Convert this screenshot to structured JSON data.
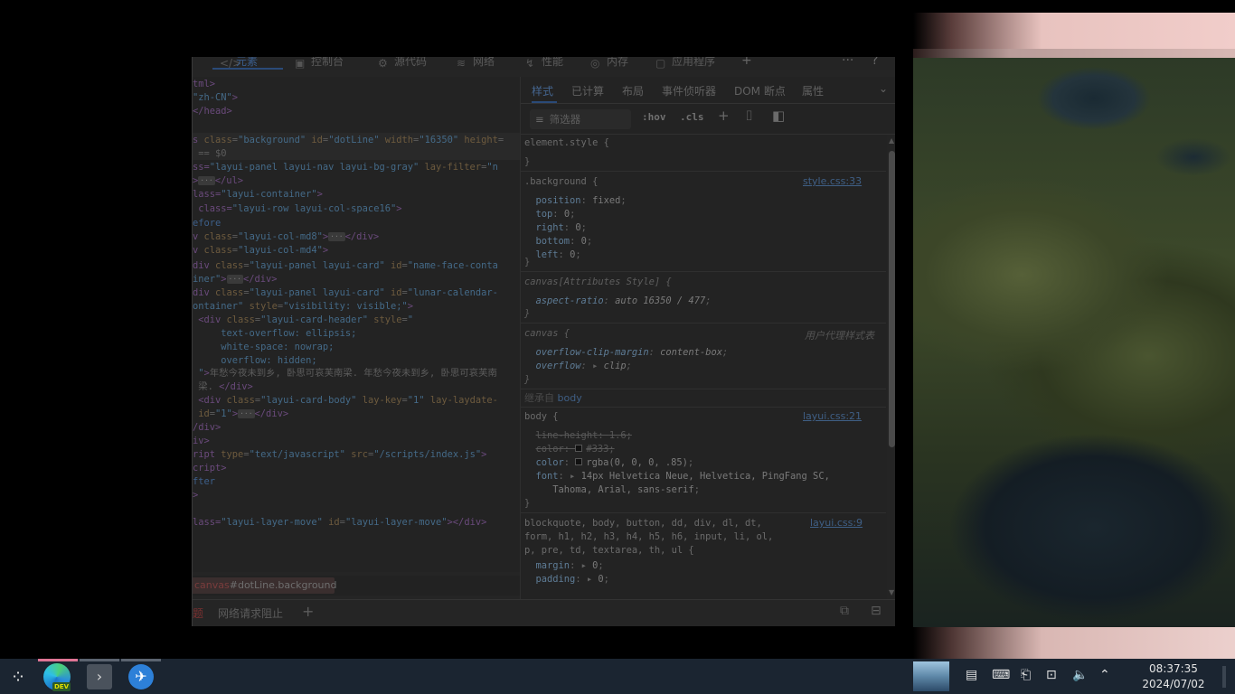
{
  "devtools": {
    "tabs": [
      {
        "label": "元素",
        "icon": "</>"
      },
      {
        "label": "控制台",
        "icon": "▣"
      },
      {
        "label": "源代码",
        "icon": "⚙"
      },
      {
        "label": "网络",
        "icon": "≋"
      },
      {
        "label": "性能",
        "icon": "↯"
      },
      {
        "label": "内存",
        "icon": "◎"
      },
      {
        "label": "应用程序",
        "icon": "▢"
      }
    ],
    "add_tab": "+",
    "more": "···",
    "help": "?",
    "elements_lines": [
      {
        "parts": [
          [
            "tg",
            "tml>"
          ]
        ]
      },
      {
        "parts": [
          [
            "av",
            "\"zh-CN\""
          ],
          [
            "tg",
            ">"
          ]
        ]
      },
      {
        "parts": [
          [
            "tg",
            "</head>"
          ]
        ]
      },
      {
        "parts": []
      },
      {
        "parts": [
          [
            "tg",
            "s "
          ],
          [
            "an",
            "class"
          ],
          [
            "tx",
            "="
          ],
          [
            "av",
            "\"background\""
          ],
          [
            "tx",
            " "
          ],
          [
            "an",
            "id"
          ],
          [
            "tx",
            "="
          ],
          [
            "av",
            "\"dotLine\""
          ],
          [
            "tx",
            " "
          ],
          [
            "an",
            "width"
          ],
          [
            "tx",
            "="
          ],
          [
            "av",
            "\"16350\""
          ],
          [
            "tx",
            " "
          ],
          [
            "an",
            "height"
          ],
          [
            "tx",
            "="
          ]
        ]
      },
      {
        "parts": [
          [
            "tx",
            " == $0"
          ]
        ]
      },
      {
        "parts": [
          [
            "tg",
            "ss="
          ],
          [
            "av",
            "\"layui-panel layui-nav layui-bg-gray\""
          ],
          [
            "tx",
            " "
          ],
          [
            "an",
            "lay-filter"
          ],
          [
            "tx",
            "="
          ],
          [
            "av",
            "\"n"
          ]
        ]
      },
      {
        "parts": [
          [
            "tg",
            ">"
          ],
          [
            "ell",
            "···"
          ],
          [
            "tg",
            "</ul>"
          ]
        ]
      },
      {
        "parts": [
          [
            "tg",
            "lass="
          ],
          [
            "av",
            "\"layui-container\""
          ],
          [
            "tg",
            ">"
          ]
        ]
      },
      {
        "parts": [
          [
            "tg",
            " class="
          ],
          [
            "av",
            "\"layui-row layui-col-space16\""
          ],
          [
            "tg",
            ">"
          ]
        ]
      },
      {
        "parts": [
          [
            "pseudo",
            "efore"
          ]
        ]
      },
      {
        "parts": [
          [
            "tg",
            "v "
          ],
          [
            "an",
            "class"
          ],
          [
            "tx",
            "="
          ],
          [
            "av",
            "\"layui-col-md8\""
          ],
          [
            "tg",
            ">"
          ],
          [
            "ell",
            "···"
          ],
          [
            "tg",
            "</div>"
          ]
        ]
      },
      {
        "parts": [
          [
            "tg",
            "v "
          ],
          [
            "an",
            "class"
          ],
          [
            "tx",
            "="
          ],
          [
            "av",
            "\"layui-col-md4\""
          ],
          [
            "tg",
            ">"
          ]
        ]
      },
      {
        "parts": [
          [
            "tg",
            "div "
          ],
          [
            "an",
            "class"
          ],
          [
            "tx",
            "="
          ],
          [
            "av",
            "\"layui-panel layui-card\""
          ],
          [
            "tx",
            " "
          ],
          [
            "an",
            "id"
          ],
          [
            "tx",
            "="
          ],
          [
            "av",
            "\"name-face-conta"
          ]
        ]
      },
      {
        "parts": [
          [
            "av",
            "iner\""
          ],
          [
            "tg",
            ">"
          ],
          [
            "ell",
            "···"
          ],
          [
            "tg",
            "</div>"
          ]
        ]
      },
      {
        "parts": [
          [
            "tg",
            "div "
          ],
          [
            "an",
            "class"
          ],
          [
            "tx",
            "="
          ],
          [
            "av",
            "\"layui-panel layui-card\""
          ],
          [
            "tx",
            " "
          ],
          [
            "an",
            "id"
          ],
          [
            "tx",
            "="
          ],
          [
            "av",
            "\"lunar-calendar-"
          ]
        ]
      },
      {
        "parts": [
          [
            "av",
            "ontainer\""
          ],
          [
            "tx",
            " "
          ],
          [
            "an",
            "style"
          ],
          [
            "tx",
            "="
          ],
          [
            "av",
            "\"visibility: visible;\""
          ],
          [
            "tg",
            ">"
          ]
        ]
      },
      {
        "parts": [
          [
            "tg",
            " <div "
          ],
          [
            "an",
            "class"
          ],
          [
            "tx",
            "="
          ],
          [
            "av",
            "\"layui-card-header\""
          ],
          [
            "tx",
            " "
          ],
          [
            "an",
            "style"
          ],
          [
            "tx",
            "="
          ],
          [
            "av",
            "\""
          ]
        ]
      },
      {
        "parts": [
          [
            "av",
            "     text-overflow: ellipsis;"
          ]
        ]
      },
      {
        "parts": [
          [
            "av",
            "     white-space: nowrap;"
          ]
        ]
      },
      {
        "parts": [
          [
            "av",
            "     overflow: hidden;"
          ]
        ]
      },
      {
        "parts": [
          [
            "av",
            " \""
          ],
          [
            "tg",
            ">"
          ],
          [
            "tx",
            "年愁今夜未到乡, 卧思可哀芙南梁. 年愁今夜未到乡, 卧思可哀芙南"
          ]
        ]
      },
      {
        "parts": [
          [
            "tx",
            " 梁. "
          ],
          [
            "tg",
            "</div>"
          ]
        ]
      },
      {
        "parts": [
          [
            "tg",
            " <div "
          ],
          [
            "an",
            "class"
          ],
          [
            "tx",
            "="
          ],
          [
            "av",
            "\"layui-card-body\""
          ],
          [
            "tx",
            " "
          ],
          [
            "an",
            "lay-key"
          ],
          [
            "tx",
            "="
          ],
          [
            "av",
            "\"1\""
          ],
          [
            "tx",
            " "
          ],
          [
            "an",
            "lay-laydate-"
          ]
        ]
      },
      {
        "parts": [
          [
            "an",
            " id"
          ],
          [
            "tx",
            "="
          ],
          [
            "av",
            "\"1\""
          ],
          [
            "tg",
            ">"
          ],
          [
            "ell",
            "···"
          ],
          [
            "tg",
            "</div>"
          ]
        ]
      },
      {
        "parts": [
          [
            "tg",
            "/div>"
          ]
        ]
      },
      {
        "parts": [
          [
            "tg",
            "iv>"
          ]
        ]
      },
      {
        "parts": [
          [
            "tg",
            "ript "
          ],
          [
            "an",
            "type"
          ],
          [
            "tx",
            "="
          ],
          [
            "av",
            "\"text/javascript\""
          ],
          [
            "tx",
            " "
          ],
          [
            "an",
            "src"
          ],
          [
            "tx",
            "="
          ],
          [
            "av",
            "\"/scripts/index.js\""
          ],
          [
            "tg",
            ">"
          ]
        ]
      },
      {
        "parts": [
          [
            "tg",
            "cript>"
          ]
        ]
      },
      {
        "parts": [
          [
            "pseudo",
            "fter"
          ]
        ]
      },
      {
        "parts": [
          [
            "tg",
            ">"
          ]
        ]
      },
      {
        "parts": []
      },
      {
        "parts": [
          [
            "tg",
            "lass="
          ],
          [
            "av",
            "\"layui-layer-move\""
          ],
          [
            "tx",
            " "
          ],
          [
            "an",
            "id"
          ],
          [
            "tx",
            "="
          ],
          [
            "av",
            "\"layui-layer-move\""
          ],
          [
            "tg",
            "></div>"
          ]
        ]
      }
    ],
    "breadcrumb": {
      "tag": "canvas",
      "rest": "#dotLine.background"
    },
    "bottom": {
      "left_label": "题",
      "drawer_tab": "网络请求阻止",
      "add": "+"
    },
    "styles_tabs": [
      "样式",
      "已计算",
      "布局",
      "事件侦听器",
      "DOM 断点",
      "属性"
    ],
    "filter": {
      "placeholder": "筛选器",
      "hov": ":hov",
      "cls": ".cls"
    },
    "rules": {
      "element_style": "element.style {",
      "background_sel": ".background {",
      "background_src": "style.css:33",
      "background_props": [
        [
          "position",
          "fixed"
        ],
        [
          "top",
          "0"
        ],
        [
          "right",
          "0"
        ],
        [
          "bottom",
          "0"
        ],
        [
          "left",
          "0"
        ]
      ],
      "canvas_attr_sel": "canvas[Attributes Style] {",
      "aspect": [
        "aspect-ratio",
        "auto 16350 / 477"
      ],
      "canvas_sel": "canvas {",
      "ua_label": "用户代理样式表",
      "canvas_props": [
        [
          "overflow-clip-margin",
          "content-box"
        ],
        [
          "overflow",
          "clip"
        ]
      ],
      "inherit_prefix": "继承自",
      "inherit_from": "body",
      "body_sel": "body {",
      "body_src": "layui.css:21",
      "body_props": [
        [
          "line-height",
          "1.6"
        ],
        [
          "color",
          "#333"
        ],
        [
          "color",
          "rgba(0, 0, 0, .85)"
        ],
        [
          "font",
          "14px Helvetica Neue, Helvetica, PingFang SC,"
        ]
      ],
      "font_cont": "Tahoma, Arial, sans-serif",
      "reset_sel_1": "blockquote, body, button, dd, div, dl, dt,",
      "reset_sel_2": "form, h1, h2, h3, h4, h5, h6, input, li, ol,",
      "reset_sel_3": "p, pre, td, textarea, th, ul {",
      "reset_src": "layui.css:9",
      "reset_props": [
        [
          "margin",
          "0"
        ],
        [
          "padding",
          "0"
        ]
      ],
      "close": "}"
    }
  },
  "taskbar": {
    "edge_badge": "DEV",
    "clock_time": "08:37:35",
    "clock_date": "2024/07/02"
  }
}
